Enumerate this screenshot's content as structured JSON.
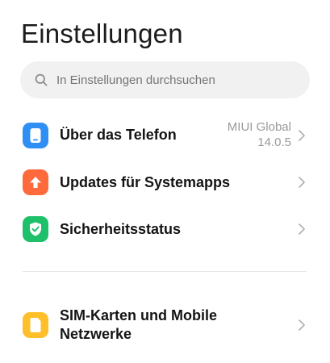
{
  "header": {
    "title": "Einstellungen"
  },
  "search": {
    "placeholder": "In Einstellungen durchsuchen",
    "icon": "search-icon"
  },
  "sections": [
    {
      "items": [
        {
          "label": "Über das Telefon",
          "value_line1": "MIUI Global",
          "value_line2": "14.0.5",
          "icon": "phone-icon",
          "icon_color": "#2f8ff5"
        },
        {
          "label": "Updates für Systemapps",
          "icon": "arrow-up-icon",
          "icon_color": "#ff6a3d"
        },
        {
          "label": "Sicherheitsstatus",
          "icon": "shield-check-icon",
          "icon_color": "#1fc06a"
        }
      ]
    },
    {
      "items": [
        {
          "label_line1": "SIM-Karten und Mobile",
          "label_line2": "Netzwerke",
          "icon": "sim-card-icon",
          "icon_color": "#ffbf2a"
        }
      ]
    }
  ],
  "colors": {
    "background": "#ffffff",
    "search_bg": "#f1f1f1",
    "muted_text": "#9a9a9a",
    "chevron": "#b0b0b0"
  }
}
